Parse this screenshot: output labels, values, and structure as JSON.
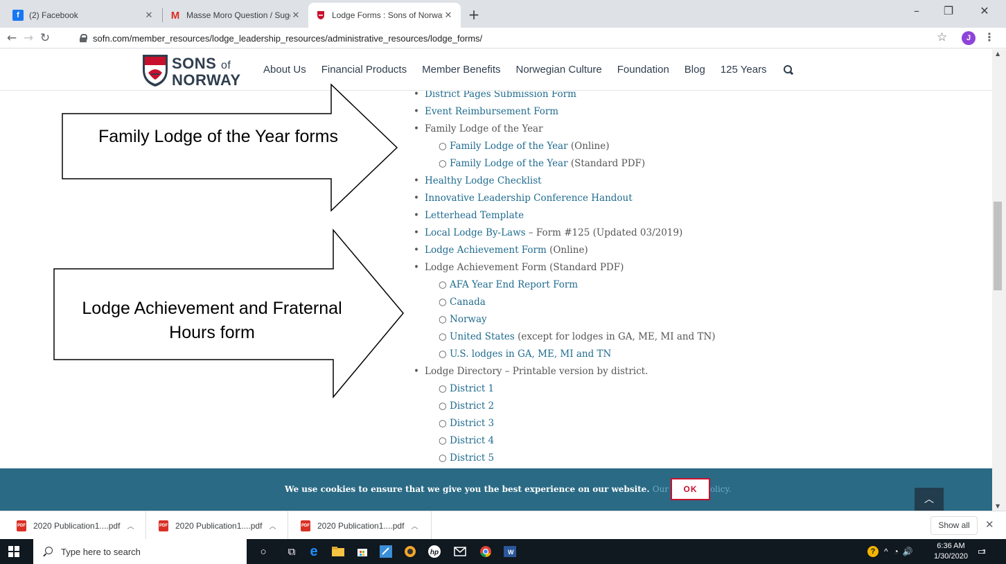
{
  "tabs": [
    {
      "title": "(2) Facebook",
      "icon": "facebook-icon",
      "color": "#1877f2"
    },
    {
      "title": "Masse Moro Question / Suggesti",
      "icon": "gmail-icon",
      "color": "#d93025"
    },
    {
      "title": "Lodge Forms : Sons of Norway",
      "icon": "sons-of-norway-icon",
      "color": "#c8102e"
    }
  ],
  "url": "sofn.com/member_resources/lodge_leadership_resources/administrative_resources/lodge_forms/",
  "profile_initial": "J",
  "site": {
    "logo_main": "SONS",
    "logo_of": "of",
    "logo_sub": "NORWAY",
    "nav": [
      "About Us",
      "Financial Products",
      "Member Benefits",
      "Norwegian Culture",
      "Foundation",
      "Blog",
      "125 Years"
    ]
  },
  "list": [
    {
      "level": 1,
      "link": "District Pages Submission Form",
      "text": ""
    },
    {
      "level": 1,
      "link": "Event Reimbursement Form",
      "text": ""
    },
    {
      "level": 1,
      "link": "",
      "text": "Family Lodge of the Year"
    },
    {
      "level": 2,
      "link": "Family Lodge of the Year",
      "text": " (Online)"
    },
    {
      "level": 2,
      "link": "Family Lodge of the Year",
      "text": " (Standard PDF)"
    },
    {
      "level": 1,
      "link": "Healthy Lodge Checklist",
      "text": ""
    },
    {
      "level": 1,
      "link": "Innovative Leadership Conference Handout",
      "text": ""
    },
    {
      "level": 1,
      "link": "Letterhead Template",
      "text": ""
    },
    {
      "level": 1,
      "link": "Local Lodge By-Laws",
      "text": " – Form #125 (Updated 03/2019)"
    },
    {
      "level": 1,
      "link": "Lodge Achievement Form",
      "text": " (Online)"
    },
    {
      "level": 1,
      "link": "",
      "text": "Lodge Achievement Form (Standard PDF)"
    },
    {
      "level": 2,
      "link": "AFA Year End Report Form",
      "text": ""
    },
    {
      "level": 2,
      "link": "Canada",
      "text": ""
    },
    {
      "level": 2,
      "link": "Norway",
      "text": ""
    },
    {
      "level": 2,
      "link": "United States",
      "text": " (except for lodges in GA, ME, MI and TN)"
    },
    {
      "level": 2,
      "link": "U.S. lodges in GA, ME, MI and TN",
      "text": ""
    },
    {
      "level": 1,
      "link": "",
      "text": "Lodge Directory – Printable version by district."
    },
    {
      "level": 2,
      "link": "District 1",
      "text": ""
    },
    {
      "level": 2,
      "link": "District 2",
      "text": ""
    },
    {
      "level": 2,
      "link": "District 3",
      "text": ""
    },
    {
      "level": 2,
      "link": "District 4",
      "text": ""
    },
    {
      "level": 2,
      "link": "District 5",
      "text": ""
    }
  ],
  "callouts": {
    "family": "Family Lodge of the Year forms",
    "achievement": "Lodge Achievement and Fraternal Hours form"
  },
  "cookie": {
    "text": "We use cookies to ensure that we give you the best experience on our website.",
    "link": "Our privacy Policy.",
    "ok": "OK"
  },
  "downloads": {
    "items": [
      "2020 Publication1....pdf",
      "2020 Publication1....pdf",
      "2020 Publication1....pdf"
    ],
    "show_all": "Show all"
  },
  "taskbar": {
    "search_placeholder": "Type here to search",
    "time": "6:36 AM",
    "date": "1/30/2020",
    "notification_count": "7"
  }
}
